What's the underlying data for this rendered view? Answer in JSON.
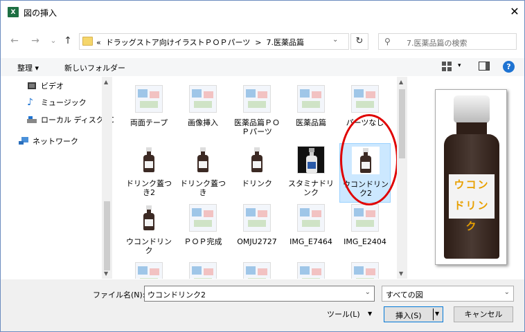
{
  "window": {
    "title": "図の挿入",
    "close_glyph": "✕",
    "app_icon": "X"
  },
  "nav": {
    "back": "←",
    "forward": "→",
    "up": "↑",
    "address_prefix": "«",
    "breadcrumbs": [
      "ドラッグストア向けイラストＰＯＰパーツ",
      "7.医薬品篇"
    ],
    "separator": ">",
    "refresh": "↻",
    "search_placeholder": "7.医薬品篇の検索",
    "chevron": "⌄"
  },
  "toolbar": {
    "organize": "整理 ▾",
    "new_folder": "新しいフォルダー"
  },
  "sidebar": {
    "items": [
      {
        "label": "ビデオ",
        "icon": "film-icon"
      },
      {
        "label": "ミュージック",
        "icon": "music-note-icon"
      },
      {
        "label": "ローカル ディスク (C",
        "icon": "drive-icon"
      },
      {
        "label": "ネットワーク",
        "icon": "network-icon"
      }
    ]
  },
  "files": [
    {
      "label": "両面テープ",
      "selected": false
    },
    {
      "label": "画像挿入",
      "selected": false
    },
    {
      "label": "医薬品篇ＰＯＰパーツ",
      "selected": false
    },
    {
      "label": "医薬品篇",
      "selected": false
    },
    {
      "label": "パーツなし",
      "selected": false
    },
    {
      "label": "ドリンク蓋つき2",
      "selected": false
    },
    {
      "label": "ドリンク蓋つき",
      "selected": false
    },
    {
      "label": "ドリンク",
      "selected": false
    },
    {
      "label": "スタミナドリンク",
      "selected": false
    },
    {
      "label": "ウコンドリンク2",
      "selected": true
    },
    {
      "label": "ウコンドリンク",
      "selected": false
    },
    {
      "label": "ＰＯＰ完成",
      "selected": false
    },
    {
      "label": "OMJU2727",
      "selected": false
    },
    {
      "label": "IMG_E7464",
      "selected": false
    },
    {
      "label": "IMG_E2404",
      "selected": false
    },
    {
      "label": "",
      "selected": false
    },
    {
      "label": "",
      "selected": false
    },
    {
      "label": "",
      "selected": false
    },
    {
      "label": "",
      "selected": false
    },
    {
      "label": "",
      "selected": false
    }
  ],
  "preview": {
    "line1": "ウコン",
    "line2": "ドリンク"
  },
  "footer": {
    "filename_label": "ファイル名(N):",
    "filename_value": "ウコンドリンク2",
    "filter_value": "すべての図",
    "tools": "ツール(L)",
    "insert": "挿入(S)",
    "cancel": "キャンセル"
  },
  "colors": {
    "accent": "#0078d7",
    "highlight": "#e00000"
  }
}
